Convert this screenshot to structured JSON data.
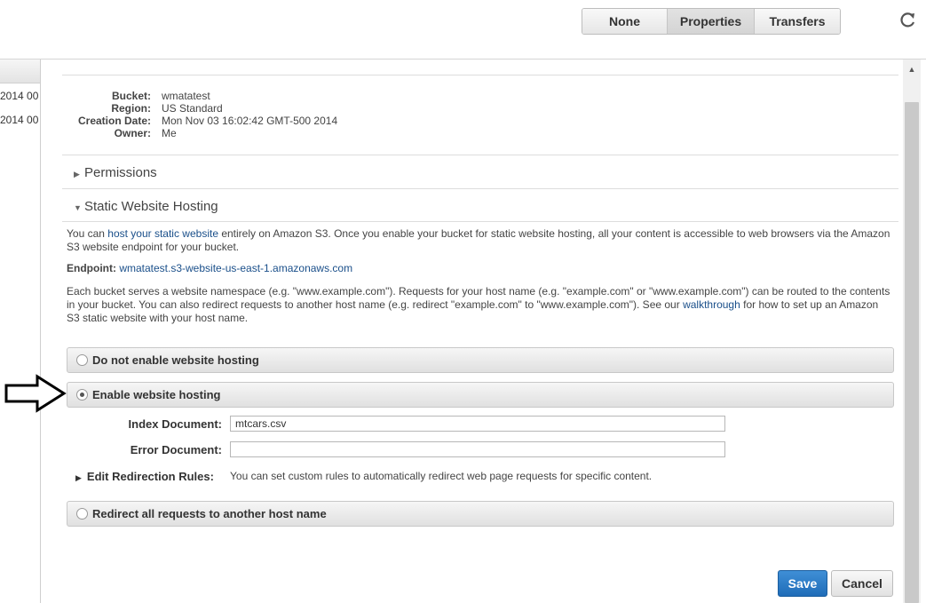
{
  "toolbar": {
    "buttons": [
      "None",
      "Properties",
      "Transfers"
    ],
    "active": "Properties"
  },
  "left_list": {
    "dates": [
      "00 2014",
      "00 2014"
    ]
  },
  "bucket": {
    "labels": {
      "bucket": "Bucket:",
      "region": "Region:",
      "creation_date": "Creation Date:",
      "owner": "Owner:"
    },
    "values": {
      "bucket": "wmatatest",
      "region": "US Standard",
      "creation_date": "Mon Nov 03 16:02:42 GMT-500 2014",
      "owner": "Me"
    }
  },
  "sections": {
    "permissions": "Permissions",
    "static_hosting": "Static Website Hosting"
  },
  "hosting": {
    "intro_pre": "You can ",
    "intro_link": "host your static website",
    "intro_post": " entirely on Amazon S3. Once you enable your bucket for static website hosting, all your content is accessible to web browsers via the Amazon S3 website endpoint for your bucket.",
    "endpoint_label": "Endpoint:",
    "endpoint_value": "wmatatest.s3-website-us-east-1.amazonaws.com",
    "namespace_pre": "Each bucket serves a website namespace (e.g. \"www.example.com\"). Requests for your host name (e.g. \"example.com\" or \"www.example.com\") can be routed to the contents in your bucket. You can also redirect requests to another host name (e.g. redirect \"example.com\" to \"www.example.com\"). See our ",
    "namespace_link": "walkthrough",
    "namespace_post": " for how to set up an Amazon S3 static website with your host name."
  },
  "options": {
    "disable": "Do not enable website hosting",
    "enable": "Enable website hosting",
    "redirect": "Redirect all requests to another host name",
    "selected": "enable"
  },
  "form": {
    "index_label": "Index Document:",
    "index_value": "mtcars.csv",
    "error_label": "Error Document:",
    "error_value": "",
    "redirection_label": "Edit Redirection Rules:",
    "redirection_text": "You can set custom rules to automatically redirect web page requests for specific content."
  },
  "actions": {
    "save": "Save",
    "cancel": "Cancel"
  }
}
